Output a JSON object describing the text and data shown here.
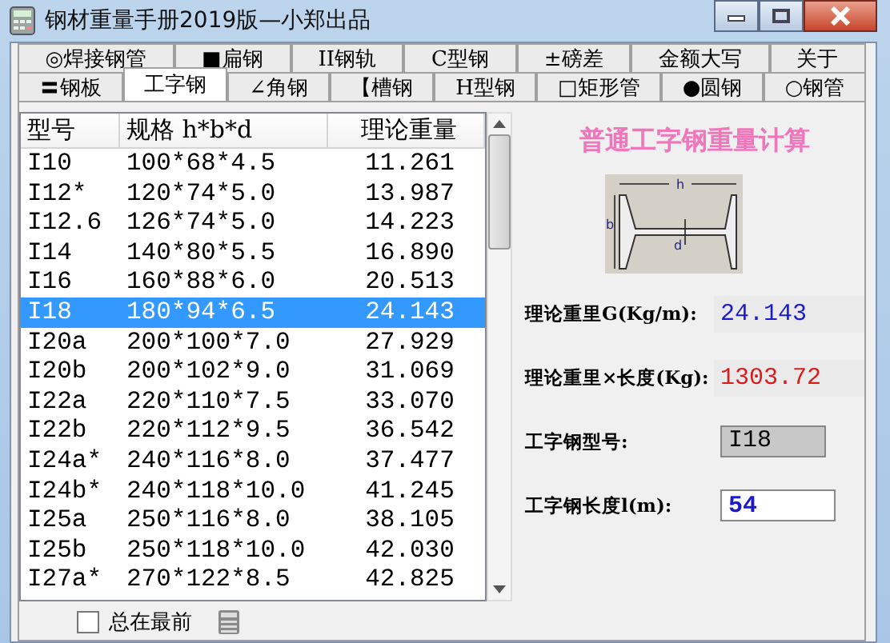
{
  "window": {
    "title": "钢材重量手册2019版—小郑出品"
  },
  "tabs": [
    [
      {
        "label": "◎焊接钢管",
        "selected": false
      },
      {
        "label": "■扁钢",
        "selected": false
      },
      {
        "label": "II钢轨",
        "selected": false
      },
      {
        "label": "C型钢",
        "selected": false
      },
      {
        "label": "±磅差",
        "selected": false
      },
      {
        "label": "金额大写",
        "selected": false
      },
      {
        "label": "关于",
        "selected": false
      }
    ],
    [
      {
        "label": "〓钢板",
        "selected": false
      },
      {
        "label": "工字钢",
        "selected": true
      },
      {
        "label": "∠角钢",
        "selected": false
      },
      {
        "label": "【槽钢",
        "selected": false
      },
      {
        "label": "H型钢",
        "selected": false
      },
      {
        "label": "□矩形管",
        "selected": false
      },
      {
        "label": "●圆钢",
        "selected": false
      },
      {
        "label": "○钢管",
        "selected": false
      }
    ]
  ],
  "table": {
    "columns": [
      "型号",
      "规格 h*b*d",
      "理论重量"
    ],
    "rows": [
      {
        "cells": [
          "I10",
          "100*68*4.5",
          "11.261"
        ],
        "selected": false
      },
      {
        "cells": [
          "I12*",
          "120*74*5.0",
          "13.987"
        ],
        "selected": false
      },
      {
        "cells": [
          "I12.6",
          "126*74*5.0",
          "14.223"
        ],
        "selected": false
      },
      {
        "cells": [
          "I14",
          "140*80*5.5",
          "16.890"
        ],
        "selected": false
      },
      {
        "cells": [
          "I16",
          "160*88*6.0",
          "20.513"
        ],
        "selected": false
      },
      {
        "cells": [
          "I18",
          "180*94*6.5",
          "24.143"
        ],
        "selected": true
      },
      {
        "cells": [
          "I20a",
          "200*100*7.0",
          "27.929"
        ],
        "selected": false
      },
      {
        "cells": [
          "I20b",
          "200*102*9.0",
          "31.069"
        ],
        "selected": false
      },
      {
        "cells": [
          "I22a",
          "220*110*7.5",
          "33.070"
        ],
        "selected": false
      },
      {
        "cells": [
          "I22b",
          "220*112*9.5",
          "36.542"
        ],
        "selected": false
      },
      {
        "cells": [
          "I24a*",
          "240*116*8.0",
          "37.477"
        ],
        "selected": false
      },
      {
        "cells": [
          "I24b*",
          "240*118*10.0",
          "41.245"
        ],
        "selected": false
      },
      {
        "cells": [
          "I25a",
          "250*116*8.0",
          "38.105"
        ],
        "selected": false
      },
      {
        "cells": [
          "I25b",
          "250*118*10.0",
          "42.030"
        ],
        "selected": false
      },
      {
        "cells": [
          "I27a*",
          "270*122*8.5",
          "42.825"
        ],
        "selected": false
      }
    ]
  },
  "panel": {
    "title": "普通工字钢重量计算",
    "diagram": {
      "h": "h",
      "b": "b",
      "d": "d"
    },
    "weight": {
      "label": "理论重里G(Kg/m):",
      "value": "24.143"
    },
    "total": {
      "label": "理论重里×长度(Kg):",
      "value": "1303.72"
    },
    "model": {
      "label": "工字钢型号:",
      "value": "I18"
    },
    "length": {
      "label": "工字钢长度l(m):",
      "value": "54"
    }
  },
  "footer": {
    "checkbox": {
      "label": "总在最前",
      "checked": false
    }
  }
}
